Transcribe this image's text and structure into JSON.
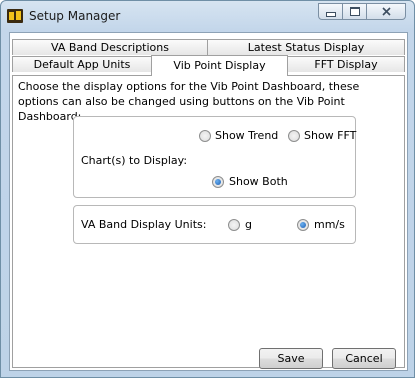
{
  "window": {
    "title": "Setup Manager",
    "app_icon": "app-logo-icon",
    "controls": {
      "minimize": "minimize-icon",
      "maximize": "maximize-icon",
      "close": "close-icon"
    }
  },
  "tabs": {
    "row1": [
      "VA Band Descriptions",
      "Latest Status Display"
    ],
    "row2": [
      "Default App Units",
      "Vib Point Display",
      "FFT Display"
    ],
    "active": "Vib Point Display"
  },
  "description": "Choose the display options for the Vib Point Dashboard, these options can also be changed using buttons on the Vib Point Dashboard:",
  "charts_group": {
    "label": "Chart(s) to Display:",
    "options": [
      {
        "label": "Show Trend",
        "checked": false
      },
      {
        "label": "Show FFT",
        "checked": false
      },
      {
        "label": "Show Both",
        "checked": true
      }
    ]
  },
  "units_group": {
    "label": "VA Band Display Units:",
    "options": [
      {
        "label": "g",
        "checked": false
      },
      {
        "label": "mm/s",
        "checked": true
      }
    ]
  },
  "buttons": {
    "save": "Save",
    "cancel": "Cancel"
  },
  "colors": {
    "title_bar": "#c9dbee",
    "radio_selected": "#1d5fb4"
  }
}
